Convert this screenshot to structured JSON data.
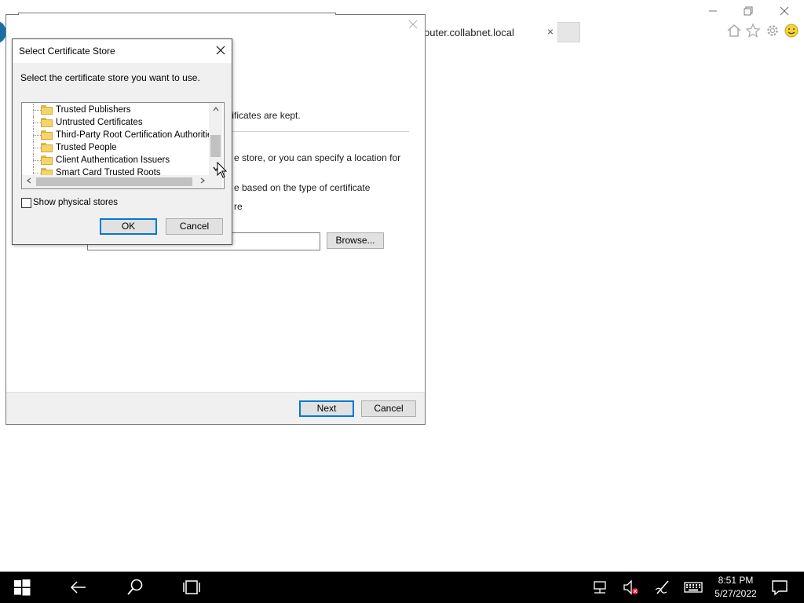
{
  "browser": {
    "tab_title": "outer.collabnet.local",
    "tab_close_glyph": "×",
    "window_controls": [
      "minimize",
      "restore",
      "close"
    ],
    "toolbar_icons": [
      "home-icon",
      "star-icon",
      "gear-icon",
      "smiley-icon"
    ]
  },
  "wizard": {
    "fragments": {
      "stored_text": "rtificates are kept.",
      "specify_text": "e store, or you can specify a location for",
      "type_text": "e based on the type of certificate",
      "store_text": "re"
    },
    "browse_label": "Browse...",
    "path_value": "",
    "next_label": "Next",
    "cancel_label": "Cancel"
  },
  "dialog": {
    "title": "Select Certificate Store",
    "instruction": "Select the certificate store you want to use.",
    "stores": [
      "Trusted Publishers",
      "Untrusted Certificates",
      "Third-Party Root Certification Authorities",
      "Trusted People",
      "Client Authentication Issuers",
      "Smart Card Trusted Roots"
    ],
    "show_physical_label": "Show physical stores",
    "show_physical_checked": false,
    "ok_label": "OK",
    "cancel_label": "Cancel"
  },
  "taskbar": {
    "time": "8:51 PM",
    "date": "5/27/2022",
    "icons": [
      "windows-start-icon",
      "back-icon",
      "search-icon",
      "task-view-icon",
      "network-icon",
      "volume-muted-icon",
      "pen-icon",
      "keyboard-icon",
      "notification-icon"
    ]
  }
}
